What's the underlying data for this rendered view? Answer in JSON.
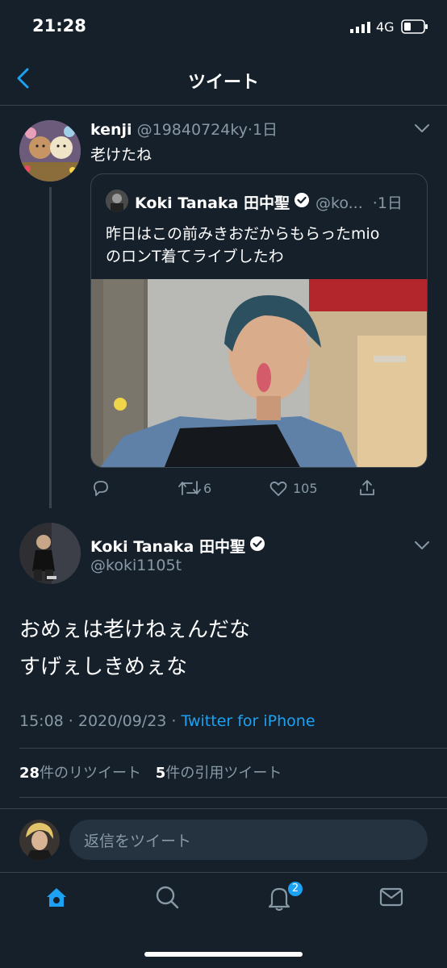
{
  "status_bar": {
    "time": "21:28",
    "network": "4G"
  },
  "header": {
    "title": "ツイート"
  },
  "parent_tweet": {
    "name": "kenji",
    "handle": "@19840724ky",
    "separator": "·",
    "time": "1日",
    "text": "老けたね",
    "quoted": {
      "name": "Koki Tanaka 田中聖",
      "handle": "@ko...",
      "separator": "·",
      "time": "1日",
      "text_line1": "昨日はこの前みきおだからもらったmio",
      "text_line2": "のロンT着てライブしたわ"
    },
    "actions": {
      "retweets": "6",
      "likes": "105"
    }
  },
  "main_tweet": {
    "name": "Koki Tanaka 田中聖",
    "handle": "@koki1105t",
    "text_line1": "おめぇは老けねぇんだな",
    "text_line2": "すげぇしきめぇな",
    "timestamp": "15:08 · 2020/09/23 · ",
    "source": "Twitter for iPhone",
    "retweet_count": "28",
    "retweet_label": "件のリツイート",
    "quote_count": "5",
    "quote_label": "件の引用ツイート"
  },
  "reply": {
    "placeholder": "返信をツイート"
  },
  "tab_bar": {
    "notification_badge": "2"
  },
  "colors": {
    "background": "#15202b",
    "accent": "#1da1f2",
    "muted": "#8899a6",
    "divider": "#38444d"
  },
  "icons": [
    "back-arrow-icon",
    "chevron-down-icon",
    "verified-badge-icon",
    "reply-icon",
    "retweet-icon",
    "like-icon",
    "share-icon",
    "home-icon",
    "search-icon",
    "notifications-icon",
    "messages-icon"
  ]
}
